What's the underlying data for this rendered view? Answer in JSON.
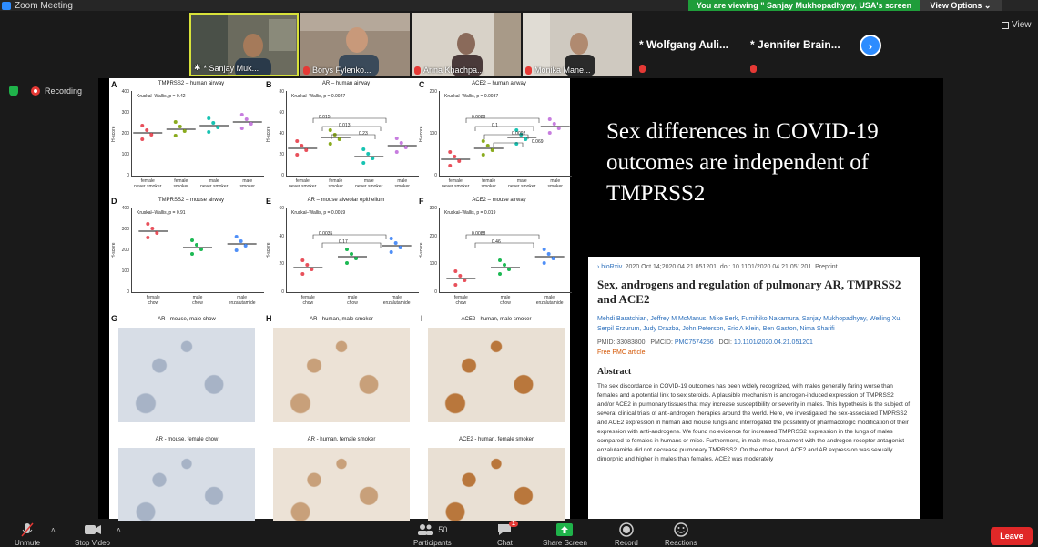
{
  "window": {
    "title": "Zoom Meeting"
  },
  "banner": {
    "viewing": "You are viewing \" Sanjay Mukhopadhyay, USA's screen",
    "view_options": "View Options ⌄"
  },
  "participants": [
    {
      "name": "* Sanjay Muk...",
      "video": true
    },
    {
      "name": "Borys Fylenko...",
      "video": true
    },
    {
      "name": "Anna Khachpa...",
      "video": true
    },
    {
      "name": "Monika Mane...",
      "video": true
    },
    {
      "name": "* Wolfgang Auli...",
      "video": false
    },
    {
      "name": "* Jennifer Brain...",
      "video": false
    }
  ],
  "view_button": "View",
  "recording_label": "Recording",
  "figure": {
    "panels": [
      {
        "letter": "A",
        "title": "TMPRSS2 – human airway",
        "stat": "Kruskal–Wallis, p = 0.42",
        "ylabel": "H-score",
        "yticks": [
          "400",
          "300",
          "200",
          "100",
          "0"
        ],
        "xlabels": [
          "female\nnever smoker",
          "female\nsmoker",
          "male\nnever smoker",
          "male\nsmoker"
        ]
      },
      {
        "letter": "B",
        "title": "AR – human airway",
        "stat": "Kruskal–Wallis, p = 0.0027",
        "ylabel": "H-score",
        "yticks": [
          "80",
          "60",
          "40",
          "20",
          "0"
        ],
        "xlabels": [
          "female\nnever smoker",
          "female\nsmoker",
          "male\nnever smoker",
          "male\nsmoker"
        ],
        "brackets": [
          "0.015",
          "0.013",
          "0.23"
        ]
      },
      {
        "letter": "C",
        "title": "ACE2 – human airway",
        "stat": "Kruskal–Wallis, p = 0.0037",
        "ylabel": "H-score",
        "yticks": [
          "200",
          "100",
          "0"
        ],
        "xlabels": [
          "female\nnever smoker",
          "female\nsmoker",
          "male\nnever smoker",
          "male\nsmoker"
        ],
        "brackets": [
          "0.0088",
          "0.1",
          "0.0092",
          "0.069"
        ]
      },
      {
        "letter": "D",
        "title": "TMPRSS2 – mouse airway",
        "stat": "Kruskal–Wallis, p = 0.91",
        "ylabel": "H-score",
        "yticks": [
          "400",
          "300",
          "200",
          "100",
          "0"
        ],
        "xlabels": [
          "female\nchow",
          "male\nchow",
          "male\nenzalutamide"
        ]
      },
      {
        "letter": "E",
        "title": "AR – mouse alveolar epithelium",
        "stat": "Kruskal–Wallis, p = 0.0019",
        "ylabel": "H-score",
        "yticks": [
          "60",
          "40",
          "20",
          "0"
        ],
        "xlabels": [
          "female\nchow",
          "male\nchow",
          "male\nenzalutamide"
        ],
        "brackets": [
          "0.0035",
          "0.17"
        ]
      },
      {
        "letter": "F",
        "title": "ACE2 – mouse airway",
        "stat": "Kruskal–Wallis, p = 0.019",
        "ylabel": "H-score",
        "yticks": [
          "300",
          "200",
          "100",
          "0"
        ],
        "xlabels": [
          "female\nchow",
          "male\nchow",
          "male\nenzalutamide"
        ],
        "brackets": [
          "0.0088",
          "0.46"
        ]
      }
    ],
    "micrographs": [
      {
        "letter": "G",
        "title": "AR - mouse, male chow"
      },
      {
        "letter": "H",
        "title": "AR - human, male smoker"
      },
      {
        "letter": "I",
        "title": "ACE2 - human, male smoker"
      },
      {
        "letter": "",
        "title": "AR - mouse, female chow"
      },
      {
        "letter": "",
        "title": "AR - human, female smoker"
      },
      {
        "letter": "",
        "title": "ACE2 - human, female smoker"
      }
    ]
  },
  "slide_title": "Sex differences in COVID-19 outcomes are independent of TMPRSS2",
  "paper": {
    "source": "bioRxiv",
    "citation": ". 2020 Oct 14;2020.04.21.051201. doi: 10.1101/2020.04.21.051201. Preprint",
    "title": "Sex, androgens and regulation of pulmonary AR, TMPRSS2 and ACE2",
    "authors": "Mehdi Baratchian, Jeffrey M McManus, Mike Berk, Fumihiko Nakamura, Sanjay Mukhopadhyay, Weiling Xu, Serpil Erzurum, Judy Drazba, John Peterson, Eric A Klein, Ben Gaston, Nima Sharifi",
    "pmid": "PMID: 33083800",
    "pmcid_label": "PMCID:",
    "pmcid": "PMC7574256",
    "doi_label": "DOI:",
    "doi": "10.1101/2020.04.21.051201",
    "free": "Free PMC article",
    "abstract_heading": "Abstract",
    "abstract": "The sex discordance in COVID-19 outcomes has been widely recognized, with males generally faring worse than females and a potential link to sex steroids. A plausible mechanism is androgen-induced expression of TMPRSS2 and/or ACE2 in pulmonary tissues that may increase susceptibility or severity in males. This hypothesis is the subject of several clinical trials of anti-androgen therapies around the world. Here, we investigated the sex-associated TMPRSS2 and ACE2 expression in human and mouse lungs and interrogated the possibility of pharmacologic modification of their expression with anti-androgens. We found no evidence for increased TMPRSS2 expression in the lungs of males compared to females in humans or mice. Furthermore, in male mice, treatment with the androgen receptor antagonist enzalutamide did not decrease pulmonary TMPRSS2. On the other hand, ACE2 and AR expression was sexually dimorphic and higher in males than females. ACE2 was moderately"
  },
  "toolbar": {
    "unmute": "Unmute",
    "stop_video": "Stop Video",
    "participants": "Participants",
    "participants_count": "50",
    "chat": "Chat",
    "chat_badge": "1",
    "share": "Share Screen",
    "record": "Record",
    "reactions": "Reactions",
    "leave": "Leave"
  },
  "colors": {
    "accent": "#2d8cff",
    "leave": "#e02828",
    "banner": "#1f9d3a",
    "share_green": "#1fb34a",
    "recording": "#e53935"
  }
}
